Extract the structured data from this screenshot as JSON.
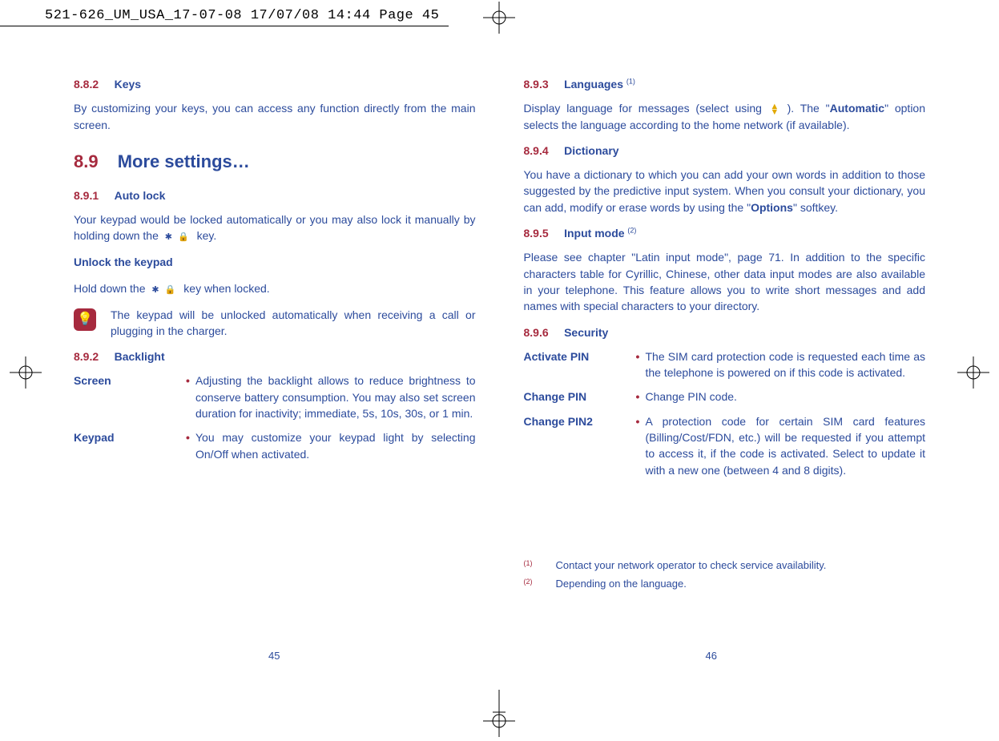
{
  "printHeader": "521-626_UM_USA_17-07-08  17/07/08  14:44  Page 45",
  "left": {
    "s882": {
      "num": "8.8.2",
      "title": "Keys"
    },
    "s882_para": "By customizing your keys, you can access any function directly from the main screen.",
    "s89": {
      "num": "8.9",
      "title": "More settings…"
    },
    "s891": {
      "num": "8.9.1",
      "title": "Auto lock"
    },
    "s891_para_a": "Your keypad would be locked automatically or you may also lock it manually by holding down the ",
    "s891_para_b": " key.",
    "unlock_h": "Unlock the keypad",
    "unlock_a": "Hold down the ",
    "unlock_b": " key when locked.",
    "note": "The keypad will be unlocked automatically when receiving a call or plugging in the charger.",
    "s892": {
      "num": "8.9.2",
      "title": "Backlight"
    },
    "screen_term": "Screen",
    "screen_desc": "Adjusting the backlight allows to reduce brightness to conserve battery consumption. You may also set screen duration for inactivity; immediate, 5s, 10s, 30s, or 1 min.",
    "keypad_term": "Keypad",
    "keypad_desc": "You may customize your keypad light by selecting On/Off when activated."
  },
  "right": {
    "s893": {
      "num": "8.9.3",
      "title_a": "Languages ",
      "sup": "(1)"
    },
    "s893_para_a": "Display language for messages (select using ",
    "s893_para_b": "). The \"",
    "s893_auto": "Automatic",
    "s893_para_c": "\" option selects the language according to the home network (if available).",
    "s894": {
      "num": "8.9.4",
      "title": "Dictionary"
    },
    "s894_para_a": "You have a dictionary to which you can add your own words in addition to those suggested by the predictive input system. When you consult your dictionary, you can add, modify or erase words by using the \"",
    "s894_opt": "Options",
    "s894_para_b": "\" softkey.",
    "s895": {
      "num": "8.9.5",
      "title_a": "Input mode ",
      "sup": "(2)"
    },
    "s895_para": "Please see chapter \"Latin input mode\", page 71. In addition to the specific characters table for Cyrillic, Chinese, other data input modes are also available in your telephone. This feature allows you to write short messages and add names with special characters to your directory.",
    "s896": {
      "num": "8.9.6",
      "title": "Security"
    },
    "act_pin_term": "Activate PIN",
    "act_pin_desc": "The SIM card protection code is requested each time as the telephone is powered on if this code is activated.",
    "chg_pin_term": "Change PIN",
    "chg_pin_desc": "Change PIN code.",
    "chg_pin2_term": "Change PIN2",
    "chg_pin2_desc": "A protection code for certain SIM card features (Billing/Cost/FDN, etc.) will be requested if you attempt to access it, if the code is activated. Select to update it with a new one (between 4 and 8 digits).",
    "fn1_mark": "(1)",
    "fn1_text": "Contact your network operator to check service availability.",
    "fn2_mark": "(2)",
    "fn2_text": "Depending on the language."
  },
  "pagenos": {
    "left": "45",
    "right": "46"
  }
}
